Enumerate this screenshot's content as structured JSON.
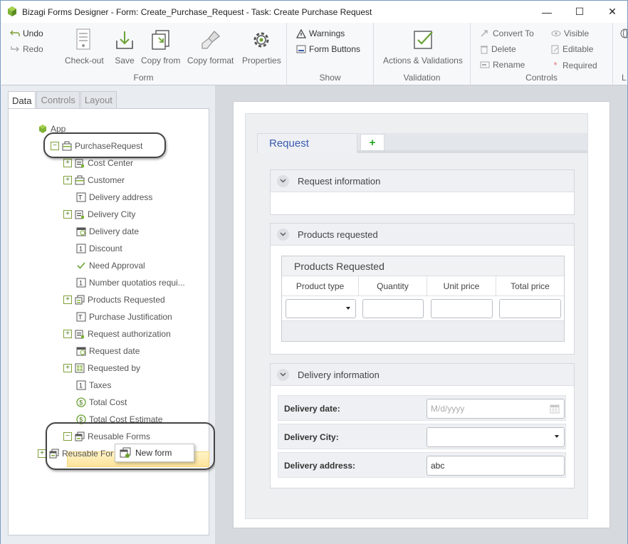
{
  "window": {
    "title": "Bizagi Forms Designer  - Form: Create_Purchase_Request - Task:  Create Purchase Request",
    "minimize": "—",
    "maximize": "☐",
    "close": "✕"
  },
  "ribbon": {
    "undo": "Undo",
    "redo": "Redo",
    "checkout": "Check-out",
    "save": "Save",
    "copy_from": "Copy from",
    "copy_format": "Copy format",
    "properties": "Properties",
    "group_form": "Form",
    "warnings": "Warnings",
    "form_buttons": "Form Buttons",
    "group_show": "Show",
    "actions_validations": "Actions & Validations",
    "group_validation": "Validation",
    "convert_to": "Convert To",
    "delete": "Delete",
    "rename": "Rename",
    "visible": "Visible",
    "editable": "Editable",
    "required": "Required",
    "group_controls": "Controls",
    "group_cut": "L"
  },
  "left_panel": {
    "tabs": [
      "Data",
      "Controls",
      "Layout"
    ],
    "tree": {
      "root": "App",
      "entity": "PurchaseRequest",
      "items": [
        "Cost Center",
        "Customer",
        "Delivery address",
        "Delivery City",
        "Delivery date",
        "Discount",
        "Need Approval",
        "Number quotatios requi...",
        "Products Requested",
        "Purchase Justification",
        "Request authorization",
        "Request date",
        "Requested by",
        "Taxes",
        "Total Cost",
        "Total Cost Estimate",
        "Reusable Forms"
      ],
      "sibling": "Reusable For"
    },
    "context_menu": {
      "new_form": "New form"
    }
  },
  "form": {
    "tab_label": "Request",
    "add_tab": "+",
    "panels": {
      "request_info": "Request information",
      "products": "Products requested",
      "delivery": "Delivery information"
    },
    "grid": {
      "title": "Products Requested",
      "columns": [
        "Product type",
        "Quantity",
        "Unit price",
        "Total price"
      ]
    },
    "delivery_fields": {
      "date_label": "Delivery date:",
      "date_placeholder": "M/d/yyyy",
      "city_label": "Delivery City:",
      "address_label": "Delivery address:",
      "address_value": "abc"
    }
  },
  "colors": {
    "accent_blue": "#3a5bb0",
    "tree_green": "#4b7b1a",
    "add_green": "#22a51f",
    "selection_yellow": "#fde49b"
  }
}
